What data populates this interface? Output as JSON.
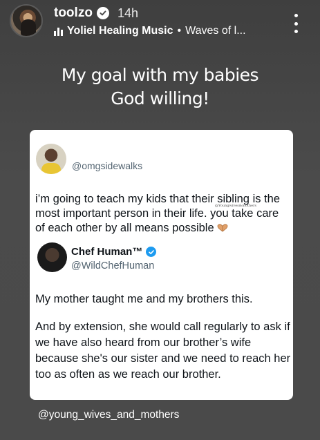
{
  "header": {
    "username": "toolzo",
    "time": "14h",
    "music_artist": "Yoliel Healing Music",
    "music_separator": "•",
    "music_track": "Waves of l..."
  },
  "caption": {
    "line1": "My goal with my babies",
    "line2": "God willing!"
  },
  "card": {
    "tweet1": {
      "handle": "@omgsidewalks",
      "text": "i’m going to teach my kids that their sibling is the most important person in their life. you take care of each other by all means possible",
      "watermark": "@Youngwives&mothers",
      "emoji_icon": "heart-hands-icon"
    },
    "tweet2": {
      "name": "Chef Human™",
      "handle": "@WildChefHuman",
      "paragraph1": "My mother taught me and my brothers this.",
      "paragraph2": "And by extension, she would call regularly to ask if we have also heard from our brother’s wife because she's our sister and we need to reach her too as often as we reach our brother."
    }
  },
  "credit": "@young_wives_and_mothers",
  "colors": {
    "background": "#4a4a4a",
    "card": "#ffffff",
    "verified_blue": "#1d9bf0",
    "handle_gray": "#536471"
  }
}
